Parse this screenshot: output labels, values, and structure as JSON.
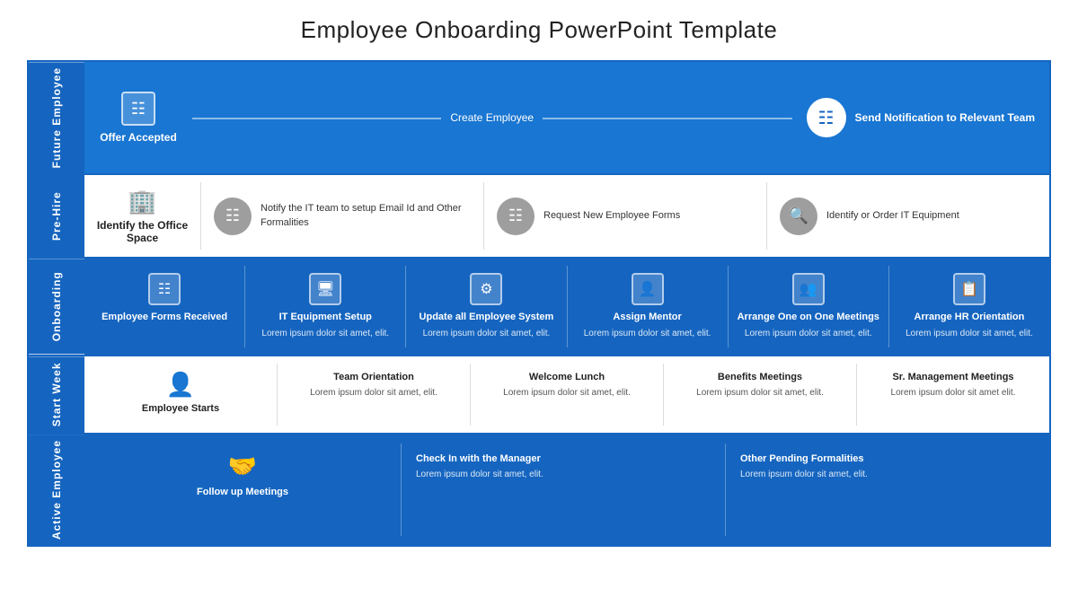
{
  "title": "Employee Onboarding PowerPoint Template",
  "rows": {
    "future": {
      "label": "Future Employee",
      "offer_accepted": "Offer Accepted",
      "create_employee": "Create Employee",
      "send_notification": "Send Notification to Relevant Team"
    },
    "prehire": {
      "label": "Pre-Hire",
      "identify_office": "Identify the Office Space",
      "notify_it": "Notify the IT team to setup Email Id and Other Formalities",
      "request_forms": "Request New Employee Forms",
      "identify_equipment": "Identify or Order IT Equipment"
    },
    "onboarding": {
      "label": "Onboarding",
      "forms_received": "Employee Forms Received",
      "it_setup_title": "IT Equipment Setup",
      "it_setup_body": "Lorem ipsum dolor sit amet, elit.",
      "update_system_title": "Update all Employee System",
      "update_system_body": "Lorem ipsum dolor sit amet, elit.",
      "assign_mentor_title": "Assign Mentor",
      "assign_mentor_body": "Lorem ipsum dolor sit amet, elit.",
      "arrange_one_title": "Arrange One on One Meetings",
      "arrange_one_body": "Lorem ipsum dolor sit amet, elit.",
      "arrange_hr_title": "Arrange HR Orientation",
      "arrange_hr_body": "Lorem ipsum dolor sit amet, elit."
    },
    "startweek": {
      "label": "Start Week",
      "employee_starts": "Employee Starts",
      "team_orientation_title": "Team Orientation",
      "team_orientation_body": "Lorem ipsum dolor sit amet, elit.",
      "welcome_lunch_title": "Welcome Lunch",
      "welcome_lunch_body": "Lorem ipsum dolor sit amet, elit.",
      "benefits_meetings_title": "Benefits Meetings",
      "benefits_meetings_body": "Lorem ipsum dolor sit amet, elit.",
      "sr_management_title": "Sr. Management Meetings",
      "sr_management_body": "Lorem ipsum dolor sit amet elit."
    },
    "active": {
      "label": "Active Employee",
      "follow_meetings": "Follow up Meetings",
      "checkin_title": "Check In with the Manager",
      "checkin_body": "Lorem ipsum dolor sit amet, elit.",
      "pending_title": "Other Pending Formalities",
      "pending_body": "Lorem ipsum dolor sit amet, elit."
    }
  }
}
